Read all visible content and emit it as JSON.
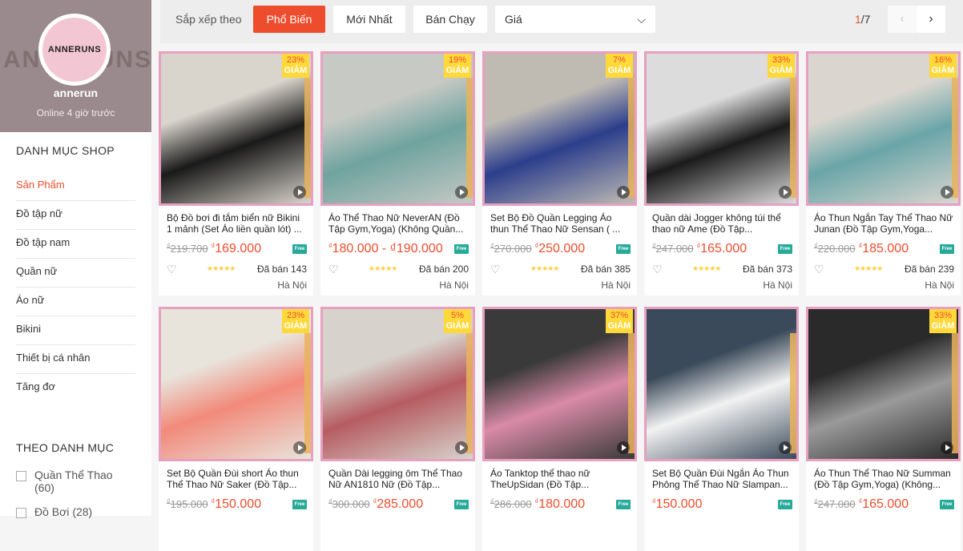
{
  "shop": {
    "logo_text": "ANNERUNS",
    "bg_text": "ANNERUNS",
    "name": "annerun",
    "status": "Online 4 giờ trước"
  },
  "sidebar": {
    "section_title": "DANH MỤC SHOP",
    "items": [
      {
        "label": "Sản Phẩm",
        "active": true
      },
      {
        "label": "Đồ tập nữ"
      },
      {
        "label": "Đồ tập nam"
      },
      {
        "label": "Quần nữ"
      },
      {
        "label": "Áo nữ"
      },
      {
        "label": "Bikini"
      },
      {
        "label": "Thiết bị cá nhân"
      },
      {
        "label": "Tăng đơ"
      }
    ],
    "filter_title": "THEO DANH MỤC",
    "filters": [
      {
        "label": "Quần Thể Thao",
        "count": "(60)"
      },
      {
        "label": "Đồ Bơi",
        "count": "(28)"
      }
    ]
  },
  "sortbar": {
    "label": "Sắp xếp theo",
    "options": [
      "Phổ Biến",
      "Mới Nhất",
      "Bán Chạy"
    ],
    "price_label": "Giá",
    "page_current": "1",
    "page_total": "/7"
  },
  "products": [
    {
      "name": "Bộ Đồ bơi đi tắm biển nữ Bikini 1 mảnh (Set Áo liền quần lót) ...",
      "old": "219.700",
      "new": "169.000",
      "discount": "23%",
      "sold": "Đã bán 143",
      "loc": "Hà Nội",
      "img": [
        "#1a1a1a",
        "#d9d4cc"
      ]
    },
    {
      "name": "Áo Thể Thao Nữ NeverAN (Đồ Tập Gym,Yoga) (Không Quần...",
      "old": "",
      "new": "180.000 - ₫190.000",
      "discount": "19%",
      "sold": "Đã bán 200",
      "loc": "Hà Nội",
      "img": [
        "#6fa39f",
        "#c6c9c4"
      ]
    },
    {
      "name": "Set Bộ Đồ Quần Legging Áo thun Thể Thao Nữ Sensan ( ...",
      "old": "270.000",
      "new": "250.000",
      "discount": "7%",
      "sold": "Đã bán 385",
      "loc": "Hà Nội",
      "img": [
        "#2c3e8c",
        "#bfbbb3"
      ]
    },
    {
      "name": "Quần dài Jogger không túi thể thao nữ Ame (Đồ Tập...",
      "old": "247.000",
      "new": "165.000",
      "discount": "33%",
      "sold": "Đã bán 373",
      "loc": "Hà Nội",
      "img": [
        "#1b1b1b",
        "#dcdcdc"
      ]
    },
    {
      "name": "Áo Thun Ngắn Tay Thể Thao Nữ Junan (Đồ Tập Gym,Yoga...",
      "old": "220.000",
      "new": "185.000",
      "discount": "16%",
      "sold": "Đã bán 239",
      "loc": "Hà Nội",
      "img": [
        "#6aa5a8",
        "#dad6cf"
      ]
    },
    {
      "name": "Set Bộ Quần Đùi short Áo thun Thể Thao Nữ Saker (Đồ Tập...",
      "old": "195.000",
      "new": "150.000",
      "discount": "23%",
      "sold": "",
      "loc": "",
      "img": [
        "#f28a7a",
        "#e8e4dc"
      ]
    },
    {
      "name": "Quần Dài legging ôm Thể Thao Nữ AN1810 Nữ (Đồ Tập...",
      "old": "300.000",
      "new": "285.000",
      "discount": "5%",
      "sold": "",
      "loc": "",
      "img": [
        "#b65c61",
        "#d7d3cc"
      ]
    },
    {
      "name": "Áo Tanktop thể thao nữ TheUpSidan (Đồ Tập...",
      "old": "286.000",
      "new": "180.000",
      "discount": "37%",
      "sold": "",
      "loc": "",
      "img": [
        "#d98aa6",
        "#3a3a3a"
      ]
    },
    {
      "name": "Set Bộ Quần Đùi Ngắn Áo Thun Phông Thể Thao Nữ Slampan...",
      "old": "",
      "new": "150.000",
      "discount": "",
      "sold": "",
      "loc": "",
      "img": [
        "#f2f2f2",
        "#3b4a5a"
      ]
    },
    {
      "name": "Áo Thun Thể Thao Nữ Summan (Đồ Tập Gym,Yoga) (Không...",
      "old": "247.000",
      "new": "165.000",
      "discount": "33%",
      "sold": "",
      "loc": "",
      "img": [
        "#9a9a9a",
        "#2a2a2a"
      ]
    }
  ],
  "icons": {
    "heart": "heart-icon",
    "play": "play-icon",
    "free_ship": "free-shipping-icon",
    "chev_down": "chevron-down-icon",
    "chev_left": "chevron-left-icon",
    "chev_right": "chevron-right-icon"
  },
  "strings": {
    "giam": "GIẢM",
    "currency": "₫",
    "stars": "★★★★★",
    "free": "Free"
  }
}
